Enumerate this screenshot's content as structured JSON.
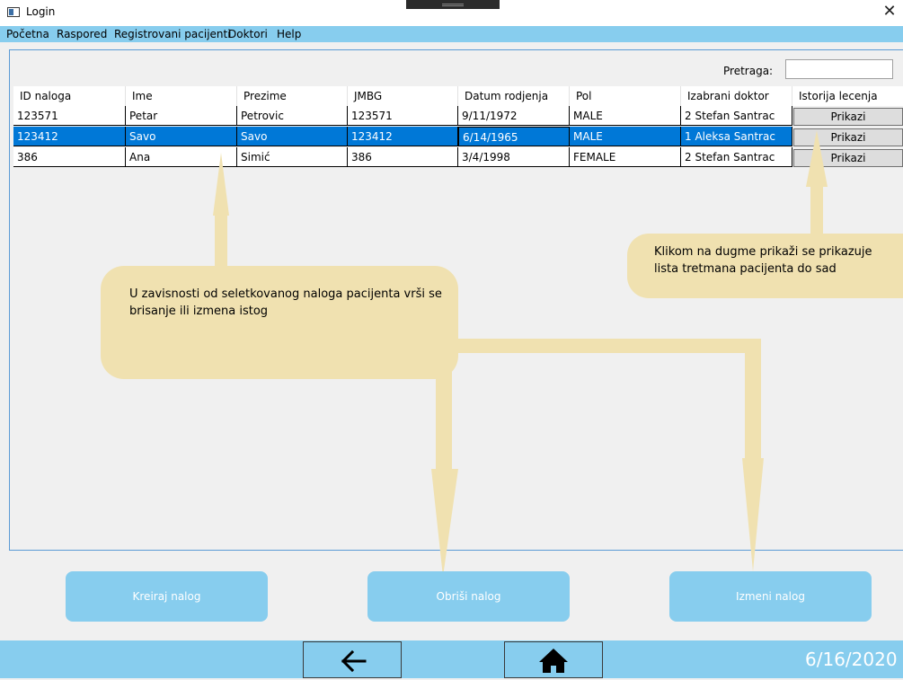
{
  "window": {
    "title": "Login",
    "close_glyph": "✕"
  },
  "menu": [
    "Početna",
    "Raspored",
    "Registrovani pacijenti",
    "Doktori",
    "Help"
  ],
  "search": {
    "label": "Pretraga:",
    "value": "",
    "placeholder": ""
  },
  "table": {
    "columns": [
      "ID naloga",
      "Ime",
      "Prezime",
      "JMBG",
      "Datum rodjenja",
      "Pol",
      "Izabrani doktor",
      "Istorija lecenja"
    ],
    "rows": [
      {
        "id": "123571",
        "ime": "Petar",
        "prezime": "Petrovic",
        "jmbg": "123571",
        "datum": "9/11/1972",
        "pol": "MALE",
        "doktor": "2 Stefan Santrac",
        "action": "Prikazi",
        "selected": false
      },
      {
        "id": "123412",
        "ime": "Savo",
        "prezime": "Savo",
        "jmbg": "123412",
        "datum": "6/14/1965",
        "pol": "MALE",
        "doktor": "1 Aleksa Santrac",
        "action": "Prikazi",
        "selected": true
      },
      {
        "id": "386",
        "ime": "Ana",
        "prezime": "Simić",
        "jmbg": "386",
        "datum": "3/4/1998",
        "pol": "FEMALE",
        "doktor": "2 Stefan Santrac",
        "action": "Prikazi",
        "selected": false
      }
    ]
  },
  "annotations": {
    "left": "U zavisnosti od seletkovanog naloga pacijenta vrši se brisanje ili izmena istog",
    "right": "Klikom na dugme prikaži se prikazuje lista tretmana pacijenta do sad"
  },
  "actions": {
    "create": "Kreiraj nalog",
    "delete": "Obriši nalog",
    "edit": "Izmeni nalog"
  },
  "footer": {
    "date": "6/16/2020",
    "back_icon": "arrow-left-icon",
    "home_icon": "home-icon"
  },
  "colors": {
    "accent": "#87cdee",
    "selection": "#0078d7",
    "callout": "#f0e1b0"
  }
}
